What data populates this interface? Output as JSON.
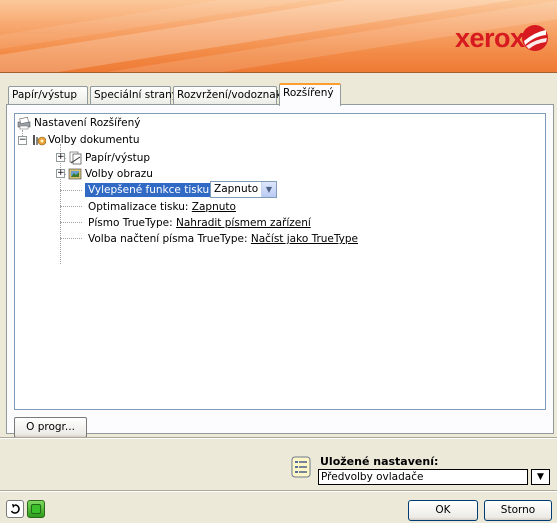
{
  "brand": {
    "logo_text": "xerox"
  },
  "tabs": [
    {
      "label": "Papír/výstup"
    },
    {
      "label": "Speciální strany"
    },
    {
      "label": "Rozvržení/vodoznak"
    },
    {
      "label": "Rozšířený",
      "active": true
    }
  ],
  "tree": {
    "root": "Nastavení Rozšířený",
    "document_options": "Volby dokumentu",
    "paper_output": "Papír/výstup",
    "image_options": "Volby obrazu",
    "enhanced_print": {
      "label": "Vylepšené funkce tisku:",
      "value": "Zapnuto"
    },
    "print_optimization": {
      "label": "Optimalizace tisku:",
      "value": "Zapnuto"
    },
    "truetype_font": {
      "label": "Písmo TrueType:",
      "value": "Nahradit písmem zařízení"
    },
    "truetype_load": {
      "label": "Volba načtení písma TrueType:",
      "value": "Načíst jako TrueType"
    }
  },
  "about_button": "O progr...",
  "saved_settings": {
    "label": "Uložené nastavení:",
    "value": "Předvolby ovladače"
  },
  "footer": {
    "ok": "OK",
    "cancel": "Storno"
  },
  "colors": {
    "banner": "#f28a45",
    "selection": "#316ac5",
    "tab_highlight": "#ff9e30"
  }
}
